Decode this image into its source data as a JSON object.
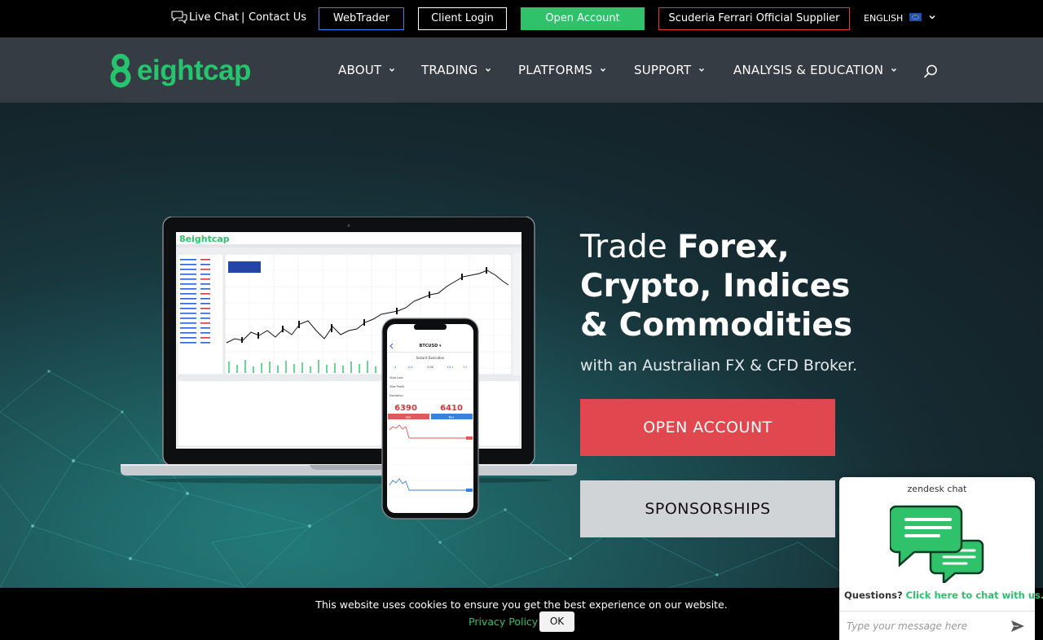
{
  "topbar": {
    "live_chat": "Live Chat",
    "separator": "|",
    "contact": "Contact Us",
    "webtrader": "WebTrader",
    "client_login": "Client Login",
    "open_account": "Open Account",
    "ferrari": "Scuderia Ferrari Official Supplier",
    "language": "ENGLISH"
  },
  "header": {
    "logo_text": "eightcap",
    "nav": [
      {
        "label": "ABOUT"
      },
      {
        "label": "TRADING"
      },
      {
        "label": "PLATFORMS"
      },
      {
        "label": "SUPPORT"
      },
      {
        "label": "ANALYSIS & EDUCATION"
      }
    ]
  },
  "hero": {
    "headline_lead": "Trade ",
    "headline_1": "Forex,",
    "headline_2": "Crypto, Indices",
    "headline_3": "& Commodities",
    "subline": "with an Australian FX & CFD Broker.",
    "cta_open": "OPEN ACCOUNT",
    "cta_sponsorships": "SPONSORSHIPS"
  },
  "cookie": {
    "text": "This website uses cookies to ensure you get the best experience on our website.",
    "privacy": "Privacy Policy",
    "ok": "OK"
  },
  "zendesk": {
    "title": "zendesk chat",
    "question": "Questions?",
    "cta": "Click here to chat with us.",
    "placeholder": "Type your message here"
  },
  "colors": {
    "brand_green": "#27c46e",
    "cta_red": "#e0474f",
    "header_bg": "#363c43",
    "topbar_bg": "#000000"
  }
}
